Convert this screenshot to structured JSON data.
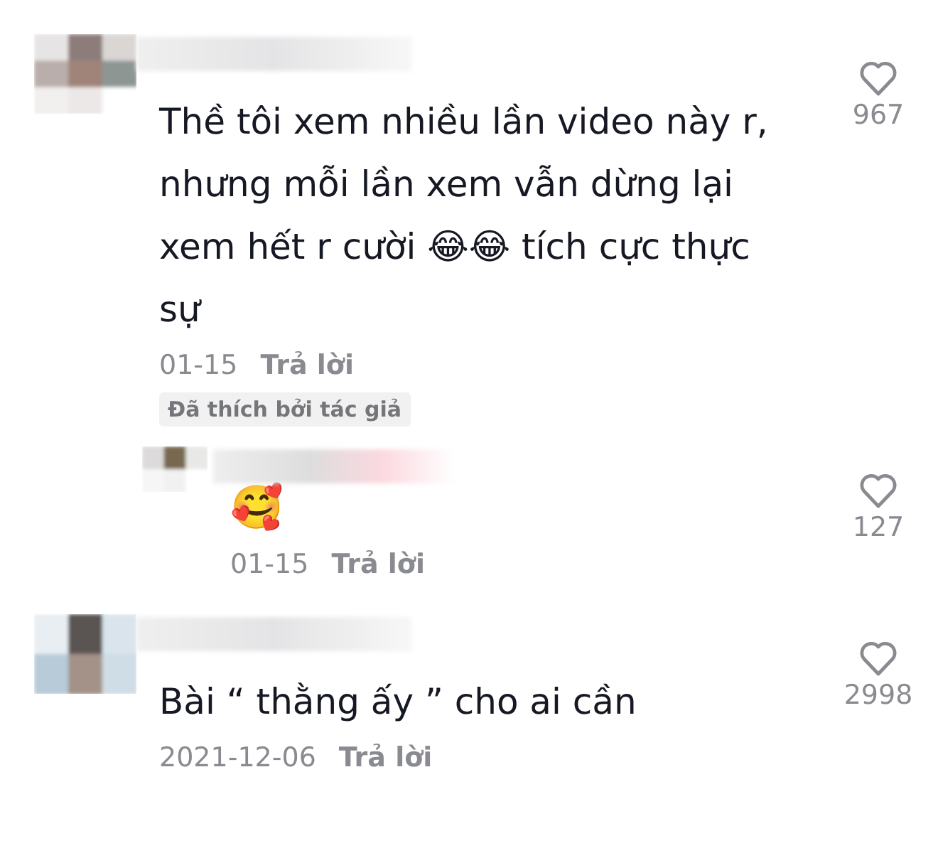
{
  "comments": [
    {
      "text": "Thề tôi xem nhiều lần video này r, nhưng mỗi lần xem vẫn dừng lại xem hết r cười 😂😂 tích cực thực sự",
      "date": "01-15",
      "reply": "Trả lời",
      "likes": "967",
      "badge": "Đã thích bởi tác giả",
      "replies": [
        {
          "text": "🥰",
          "date": "01-15",
          "reply": "Trả lời",
          "likes": "127"
        }
      ]
    },
    {
      "text": "Bài “ thằng ấy ” cho ai cần",
      "date": "2021-12-06",
      "reply": "Trả lời",
      "likes": "2998"
    }
  ]
}
